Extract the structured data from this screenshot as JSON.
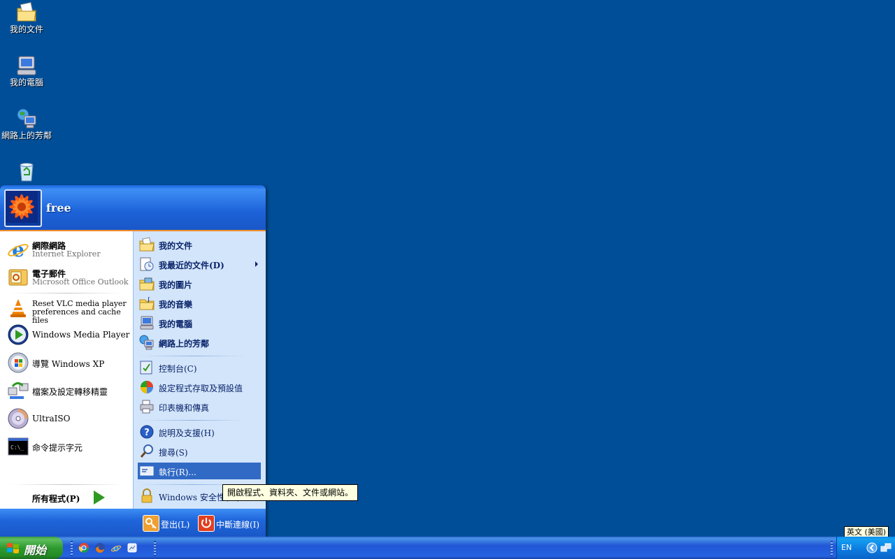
{
  "desktop": {
    "icons": [
      {
        "label": "我的文件",
        "icon": "my-documents-icon"
      },
      {
        "label": "我的電腦",
        "icon": "my-computer-icon"
      },
      {
        "label": "網路上的芳鄰",
        "icon": "network-places-icon"
      },
      {
        "label": "",
        "icon": "recycle-bin-icon"
      }
    ]
  },
  "start_menu": {
    "user_name": "free",
    "left_items": [
      {
        "title": "網際網路",
        "subtitle": "Internet Explorer",
        "icon": "internet-explorer-icon"
      },
      {
        "title": "電子郵件",
        "subtitle": "Microsoft Office Outlook",
        "icon": "outlook-icon"
      },
      {
        "title": "Reset VLC media player preferences and cache files",
        "icon": "vlc-icon"
      },
      {
        "title": "Windows Media Player",
        "icon": "media-player-icon"
      },
      {
        "title": "導覽 Windows XP",
        "icon": "tour-xp-icon"
      },
      {
        "title": "檔案及設定轉移精靈",
        "icon": "transfer-wizard-icon"
      },
      {
        "title": "UltraISO",
        "icon": "ultraiso-icon"
      },
      {
        "title": "命令提示字元",
        "icon": "command-prompt-icon"
      }
    ],
    "all_programs": "所有程式(P)",
    "right_items": [
      {
        "label": "我的文件",
        "icon": "my-documents-icon"
      },
      {
        "label": "我最近的文件(D)",
        "icon": "recent-documents-icon"
      },
      {
        "label": "我的圖片",
        "icon": "my-pictures-icon"
      },
      {
        "label": "我的音樂",
        "icon": "my-music-icon"
      },
      {
        "label": "我的電腦",
        "icon": "my-computer-icon"
      },
      {
        "label": "網路上的芳鄰",
        "icon": "network-places-icon"
      },
      {
        "label": "控制台(C)",
        "icon": "control-panel-icon"
      },
      {
        "label": "設定程式存取及預設值",
        "icon": "program-access-icon"
      },
      {
        "label": "印表機和傳真",
        "icon": "printers-icon"
      },
      {
        "label": "說明及支援(H)",
        "icon": "help-icon"
      },
      {
        "label": "搜尋(S)",
        "icon": "search-icon"
      },
      {
        "label": "執行(R)...",
        "icon": "run-icon"
      },
      {
        "label": "Windows 安全性(W)",
        "icon": "lock-icon"
      }
    ],
    "footer": {
      "logoff": "登出(L)",
      "shutdown": "中斷連線(I)"
    },
    "tooltip": "開啟程式、資料夾、文件或網站。"
  },
  "taskbar": {
    "start_label": "開始",
    "quick_launch": [
      "chrome-icon",
      "firefox-icon",
      "ie-icon",
      "show-desktop-icon"
    ],
    "tray": {
      "language": "EN",
      "language_tooltip": "英文 (美國)"
    }
  },
  "colors": {
    "desktop": "#004e98",
    "selection": "#316ac5",
    "start_green": "#2f9a2f",
    "menu_right_bg": "#d3e5fa"
  }
}
